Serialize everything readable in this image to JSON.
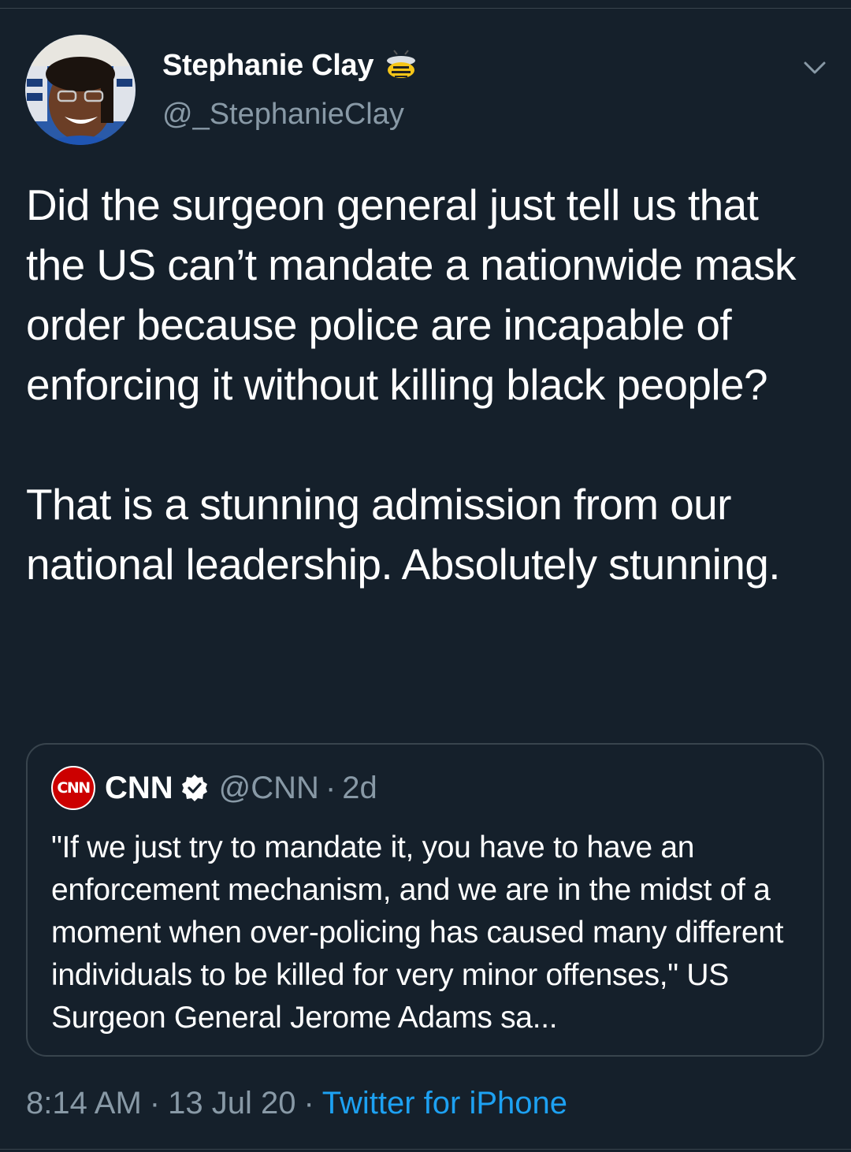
{
  "author": {
    "display_name": "Stephanie Clay",
    "handle": "@_StephanieClay"
  },
  "tweet": {
    "paragraphs": [
      "Did the surgeon general just tell us that the US can’t mandate a nationwide mask order because police are incapable of enforcing it without killing black people?",
      "That is a stunning admission from our national leadership. Absolutely stunning."
    ]
  },
  "quoted_tweet": {
    "logo_text": "CNN",
    "name": "CNN",
    "handle": "@CNN",
    "separator": "·",
    "age": "2d",
    "text": "\"If we just try to mandate it, you have to have an enforcement mechanism, and we are in the midst of a moment when over-policing has caused many different individuals to be killed for very minor offenses,\" US Surgeon General Jerome Adams sa..."
  },
  "meta": {
    "time": "8:14 AM",
    "separator": "·",
    "date": "13 Jul 20",
    "source": "Twitter for iPhone"
  },
  "colors": {
    "background": "#15202b",
    "secondary_text": "#8899a6",
    "link": "#1da1f2",
    "border": "#38444d",
    "cnn_red": "#cc0000"
  },
  "icons": {
    "emoji": "bee-icon",
    "menu": "chevron-down-icon",
    "verified": "verified-badge-icon"
  }
}
